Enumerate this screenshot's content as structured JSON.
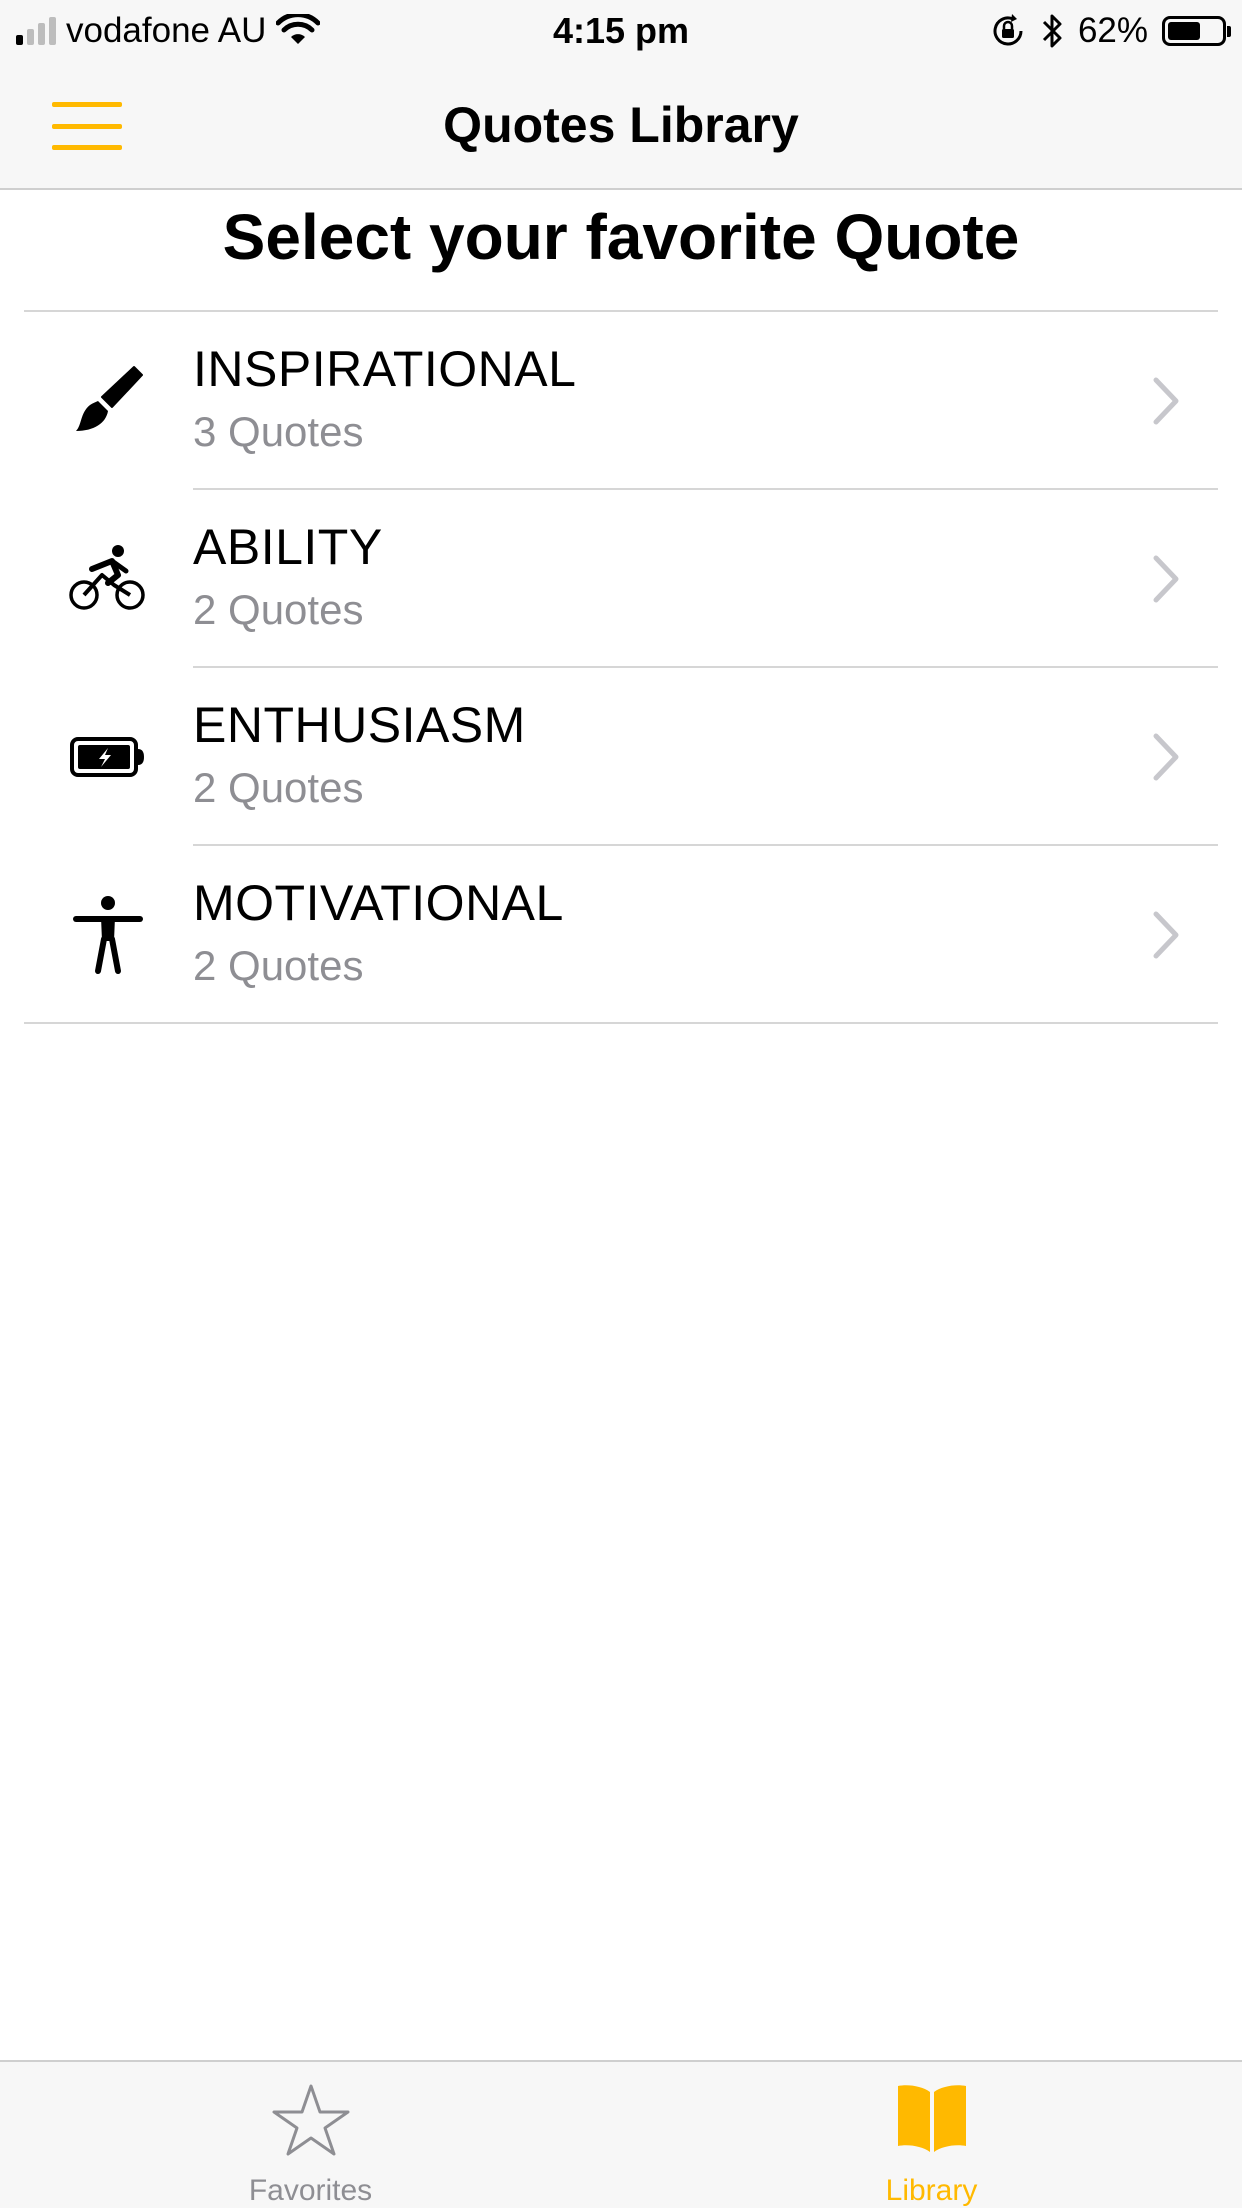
{
  "status_bar": {
    "carrier": "vodafone AU",
    "time": "4:15 pm",
    "battery_percent": "62%",
    "battery_level": 0.62,
    "signal_bars_on": 1,
    "signal_bars_total": 4
  },
  "nav": {
    "title": "Quotes Library",
    "menu_icon": "hamburger-menu-icon"
  },
  "page": {
    "heading": "Select your favorite Quote"
  },
  "categories": [
    {
      "title": "INSPIRATIONAL",
      "subtitle": "3 Quotes",
      "icon": "paintbrush-icon"
    },
    {
      "title": "ABILITY",
      "subtitle": "2 Quotes",
      "icon": "cyclist-icon"
    },
    {
      "title": "ENTHUSIASM",
      "subtitle": "2 Quotes",
      "icon": "battery-charging-icon"
    },
    {
      "title": "MOTIVATIONAL",
      "subtitle": "2 Quotes",
      "icon": "person-arms-out-icon"
    }
  ],
  "tab_bar": {
    "tabs": [
      {
        "label": "Favorites",
        "icon": "star-outline-icon",
        "active": false
      },
      {
        "label": "Library",
        "icon": "open-book-icon",
        "active": true
      }
    ]
  },
  "colors": {
    "accent": "#ffb900",
    "secondary_text": "#8e8e93",
    "separator": "#d6d6d6",
    "bar_background": "#f7f7f7"
  }
}
